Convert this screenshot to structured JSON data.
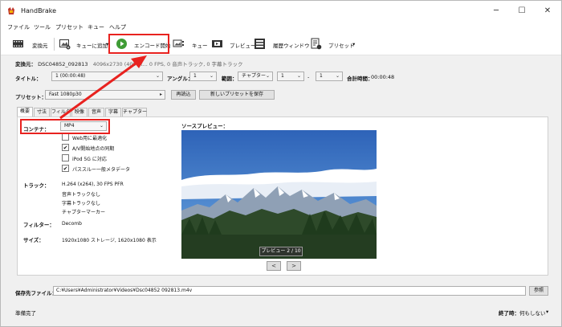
{
  "window": {
    "title": "HandBrake",
    "minimize_glyph": "─",
    "maximize_glyph": "☐",
    "close_glyph": "✕"
  },
  "menu": [
    "ファイル",
    "ツール",
    "プリセット",
    "キュー",
    "ヘルプ"
  ],
  "toolbar": {
    "source_label": "変換元",
    "add_queue_label": "キューに追加",
    "add_queue_arrow": "▾",
    "encode_label": "エンコード開始",
    "queue_label": "キュー",
    "preview_label": "プレビュー",
    "activity_label": "履歴ウィンドウ",
    "presets_label": "プリセット",
    "presets_arrow": "▾"
  },
  "source_info": {
    "label": "変換元：",
    "name": "DSC04852_092813",
    "details": "4096x2730 (4096x... 0 FPS, 0 音声トラック, 0 字幕トラック"
  },
  "title_row": {
    "title_label": "タイトル：",
    "title_value": "1 (00:00:48)",
    "angle_label": "アングル：",
    "angle_value": "1",
    "range_label": "範囲：",
    "range_value": "チャプター",
    "from_value": "1",
    "dash": "-",
    "to_value": "1",
    "duration_label": "合計時間：",
    "duration_value": "00:00:48"
  },
  "preset_row": {
    "label": "プリセット：",
    "value": "Fast 1080p30",
    "reload_label": "再読込",
    "save_new_label": "新しいプリセットを保存"
  },
  "tabs": [
    "概要",
    "寸法",
    "フィルタ",
    "映像",
    "音声",
    "字幕",
    "チャプター"
  ],
  "summary": {
    "container_label": "コンテナ：",
    "container_value": "MP4",
    "options": [
      {
        "label": "Web用に最適化",
        "checked": false
      },
      {
        "label": "A/V開始地点の同期",
        "checked": true
      },
      {
        "label": "iPod 5G に対応",
        "checked": false
      },
      {
        "label": "パススルー一般メタデータ",
        "checked": true
      }
    ],
    "check_glyph": "✔",
    "tracks_label": "トラック：",
    "tracks": [
      "H.264 (x264), 30 FPS PFR",
      "音声トラックなし",
      "字幕トラックなし",
      "チャプターマーカー"
    ],
    "filters_label": "フィルター：",
    "filters_value": "Decomb",
    "size_label": "サイズ：",
    "size_value": "1920x1080 ストレージ, 1620x1080 表示"
  },
  "preview": {
    "label": "ソースプレビュー：",
    "badge": "プレビュー 2 / 10",
    "prev_glyph": "<",
    "next_glyph": ">"
  },
  "save": {
    "label": "保存先ファイル：",
    "value": "C:¥Users¥Administrator¥Videos¥Dsc04852 092813.m4v",
    "browse_label": "参照"
  },
  "status": {
    "left": "準備完了",
    "done_label": "終了時：",
    "done_value": "何もしない",
    "done_arrow": "▾"
  },
  "colors": {
    "highlight": "#e8221f",
    "encode_green": "#3f9c35"
  }
}
